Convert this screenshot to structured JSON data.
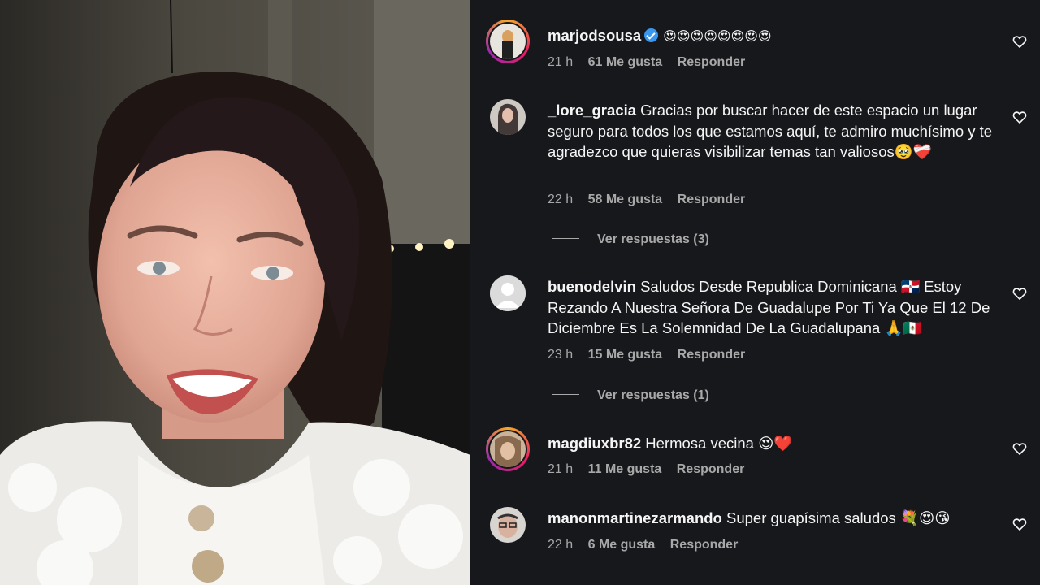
{
  "comments": [
    {
      "username": "marjodsousa",
      "verified": true,
      "text": "😍😍😍😍😍😍😍😍",
      "time": "21 h",
      "likes": "61 Me gusta",
      "reply": "Responder",
      "avatar": "story-avatar"
    },
    {
      "username": "_lore_gracia",
      "verified": false,
      "text": "Gracias por buscar hacer de este espacio un lugar seguro para todos los que estamos aquí, te admiro muchísimo y te agradezco que quieras visibilizar temas tan valiosos🥹❤️‍🩹",
      "time": "22 h",
      "likes": "58 Me gusta",
      "reply": "Responder",
      "view_replies": "Ver respuestas (3)"
    },
    {
      "username": "buenodelvin",
      "verified": false,
      "text": "Saludos Desde Republica Dominicana 🇩🇴 Estoy Rezando A Nuestra Señora De Guadalupe Por Ti Ya Que El 12 De Diciembre Es La Solemnidad De La Guadalupana 🙏🇲🇽",
      "time": "23 h",
      "likes": "15 Me gusta",
      "reply": "Responder",
      "view_replies": "Ver respuestas (1)"
    },
    {
      "username": "magdiuxbr82",
      "verified": false,
      "text": "Hermosa vecina 😍❤️",
      "time": "21 h",
      "likes": "11 Me gusta",
      "reply": "Responder"
    },
    {
      "username": "manonmartinezarmando",
      "verified": false,
      "text": "Super guapísima saludos 💐😍😘",
      "time": "22 h",
      "likes": "6 Me gusta",
      "reply": "Responder"
    }
  ],
  "icons": {
    "like": "heart-outline-icon",
    "verified": "verified-badge-icon"
  },
  "colors": {
    "panel_bg": "#17181c",
    "muted_text": "#a8a8a8",
    "verified_blue": "#3897f0"
  }
}
